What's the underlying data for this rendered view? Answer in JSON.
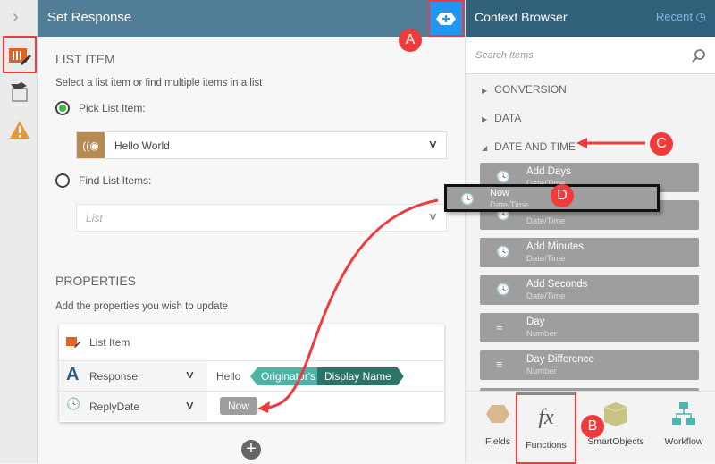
{
  "left_panel": {
    "title": "Set Response",
    "list_item": {
      "heading": "LIST ITEM",
      "desc": "Select a list item or find multiple items in a list",
      "pick_label": "Pick List Item:",
      "pick_value": "Hello World",
      "find_label": "Find List Items:",
      "list_placeholder": "List"
    },
    "properties": {
      "heading": "PROPERTIES",
      "desc": "Add the properties you wish to update",
      "table_title": "List Item",
      "rows": [
        {
          "name": "Response",
          "text": "Hello",
          "tokens": [
            "Originator's",
            "Display Name"
          ]
        },
        {
          "name": "ReplyDate",
          "token": "Now"
        }
      ]
    }
  },
  "context_browser": {
    "title": "Context Browser",
    "recent": "Recent",
    "search_placeholder": "Search Items",
    "categories": [
      "CONVERSION",
      "DATA",
      "DATE AND TIME"
    ],
    "items": [
      {
        "title": "Add Days",
        "sub": "Date/Time"
      },
      {
        "title": "Add Hours",
        "sub": "Date/Time"
      },
      {
        "title": "Add Minutes",
        "sub": "Date/Time"
      },
      {
        "title": "Add Seconds",
        "sub": "Date/Time"
      },
      {
        "title": "Day",
        "sub": "Number"
      },
      {
        "title": "Day Difference",
        "sub": "Number"
      }
    ],
    "drag_item": {
      "title": "Now",
      "sub": "Date/Time"
    },
    "tabs": [
      "Fields",
      "Functions",
      "SmartObjects",
      "Workflow"
    ]
  },
  "annotations": [
    "A",
    "B",
    "C",
    "D"
  ],
  "colors": {
    "header": "#527d96",
    "context_header": "#31617a",
    "accent_red": "#ef3b3b",
    "token_light": "#4db3a6",
    "token_dark": "#2b7468"
  }
}
